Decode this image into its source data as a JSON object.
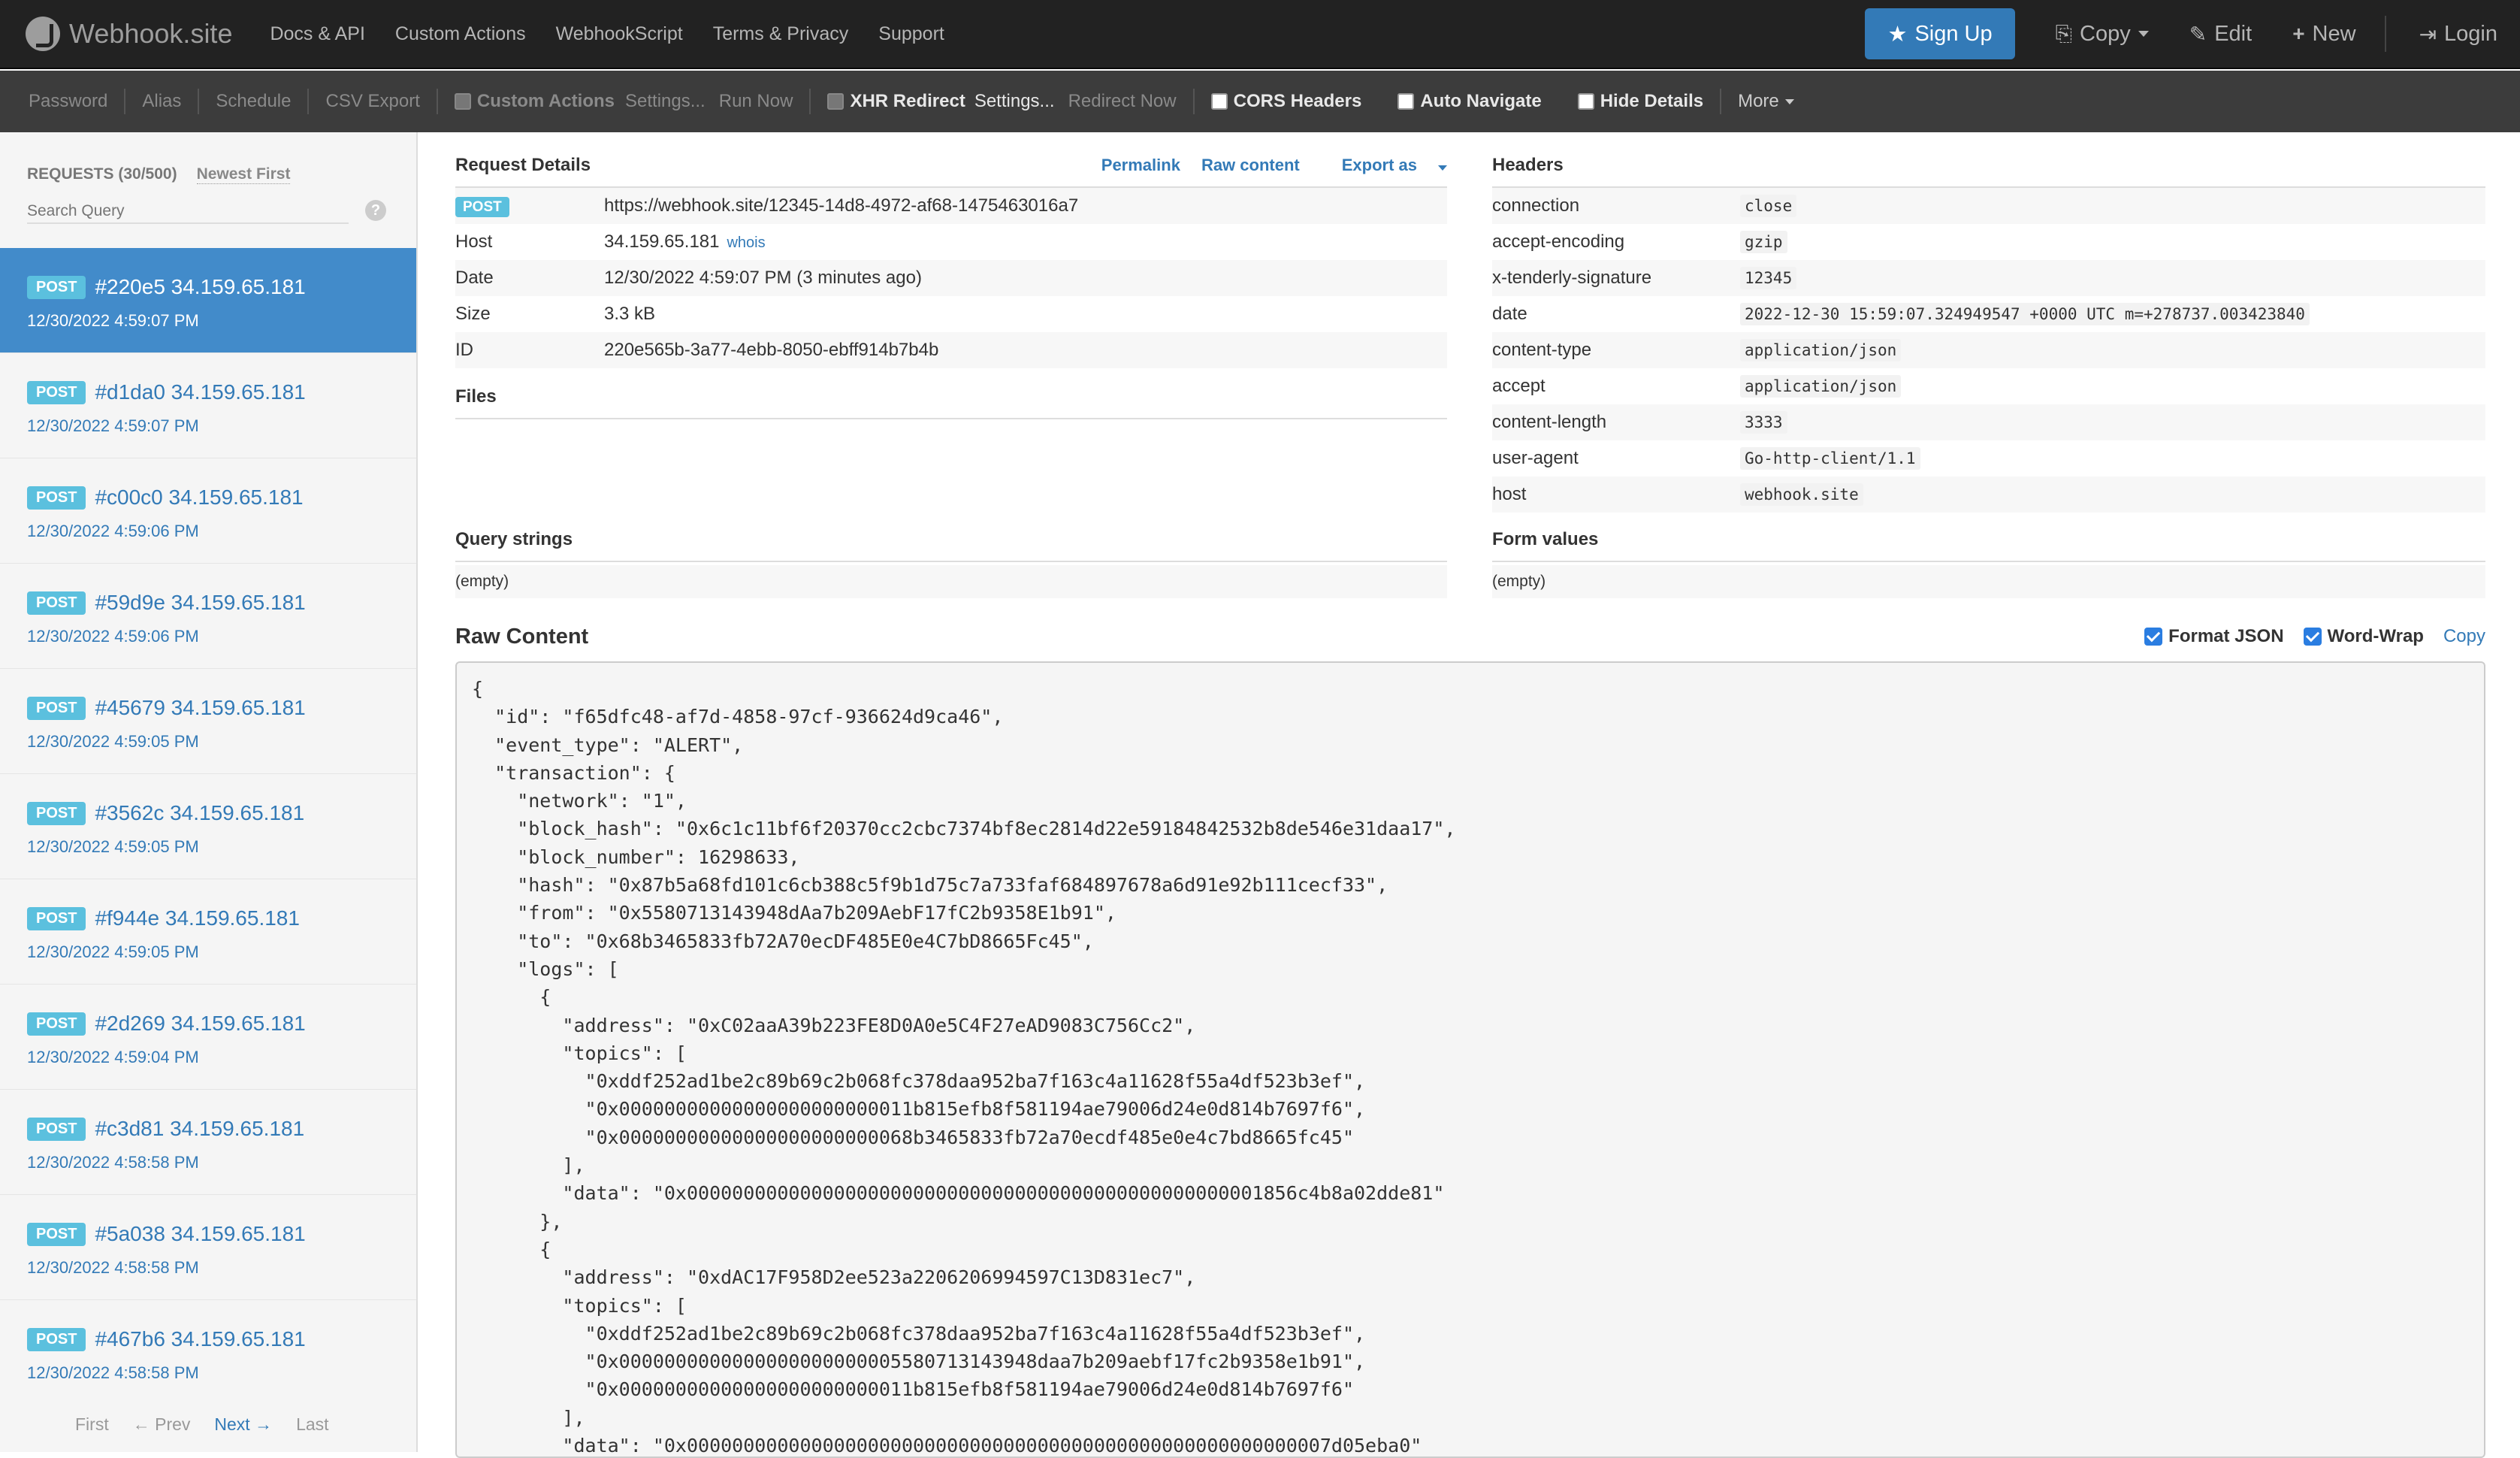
{
  "navbar": {
    "brand": "Webhook.site",
    "links": [
      "Docs & API",
      "Custom Actions",
      "WebhookScript",
      "Terms & Privacy",
      "Support"
    ],
    "signup": "Sign Up",
    "copy": "Copy",
    "edit": "Edit",
    "new": "New",
    "login": "Login"
  },
  "toolbar": {
    "password": "Password",
    "alias": "Alias",
    "schedule": "Schedule",
    "csv_export": "CSV Export",
    "custom_actions": "Custom Actions",
    "custom_settings": "Settings...",
    "run_now": "Run Now",
    "xhr_redirect": "XHR Redirect",
    "xhr_settings": "Settings...",
    "redirect_now": "Redirect Now",
    "cors_headers": "CORS Headers",
    "auto_navigate": "Auto Navigate",
    "hide_details": "Hide Details",
    "more": "More"
  },
  "sidebar": {
    "count": "REQUESTS (30/500)",
    "sort": "Newest First",
    "search_placeholder": "Search Query",
    "help": "?",
    "requests": [
      {
        "method": "POST",
        "title": "#220e5 34.159.65.181",
        "date": "12/30/2022 4:59:07 PM"
      },
      {
        "method": "POST",
        "title": "#d1da0 34.159.65.181",
        "date": "12/30/2022 4:59:07 PM"
      },
      {
        "method": "POST",
        "title": "#c00c0 34.159.65.181",
        "date": "12/30/2022 4:59:06 PM"
      },
      {
        "method": "POST",
        "title": "#59d9e 34.159.65.181",
        "date": "12/30/2022 4:59:06 PM"
      },
      {
        "method": "POST",
        "title": "#45679 34.159.65.181",
        "date": "12/30/2022 4:59:05 PM"
      },
      {
        "method": "POST",
        "title": "#3562c 34.159.65.181",
        "date": "12/30/2022 4:59:05 PM"
      },
      {
        "method": "POST",
        "title": "#f944e 34.159.65.181",
        "date": "12/30/2022 4:59:05 PM"
      },
      {
        "method": "POST",
        "title": "#2d269 34.159.65.181",
        "date": "12/30/2022 4:59:04 PM"
      },
      {
        "method": "POST",
        "title": "#c3d81 34.159.65.181",
        "date": "12/30/2022 4:58:58 PM"
      },
      {
        "method": "POST",
        "title": "#5a038 34.159.65.181",
        "date": "12/30/2022 4:58:58 PM"
      },
      {
        "method": "POST",
        "title": "#467b6 34.159.65.181",
        "date": "12/30/2022 4:58:58 PM"
      }
    ],
    "pager": {
      "first": "First",
      "prev": "← Prev",
      "next": "Next →",
      "last": "Last"
    }
  },
  "request_details": {
    "title": "Request Details",
    "permalink": "Permalink",
    "raw_content": "Raw content",
    "export_as": "Export as",
    "method": "POST",
    "url": "https://webhook.site/12345-14d8-4972-af68-1475463016a7",
    "host_label": "Host",
    "host": "34.159.65.181",
    "whois": "whois",
    "date_label": "Date",
    "date": "12/30/2022 4:59:07 PM (3 minutes ago)",
    "size_label": "Size",
    "size": "3.3 kB",
    "id_label": "ID",
    "id": "220e565b-3a77-4ebb-8050-ebff914b7b4b"
  },
  "headers": {
    "title": "Headers",
    "rows": [
      {
        "key": "connection",
        "value": "close"
      },
      {
        "key": "accept-encoding",
        "value": "gzip"
      },
      {
        "key": "x-tenderly-signature",
        "value": "12345"
      },
      {
        "key": "date",
        "value": "2022-12-30 15:59:07.324949547 +0000 UTC m=+278737.003423840"
      },
      {
        "key": "content-type",
        "value": "application/json"
      },
      {
        "key": "accept",
        "value": "application/json"
      },
      {
        "key": "content-length",
        "value": "3333"
      },
      {
        "key": "user-agent",
        "value": "Go-http-client/1.1"
      },
      {
        "key": "host",
        "value": "webhook.site"
      }
    ]
  },
  "files": {
    "title": "Files"
  },
  "query_strings": {
    "title": "Query strings",
    "value": "(empty)"
  },
  "form_values": {
    "title": "Form values",
    "value": "(empty)"
  },
  "raw": {
    "title": "Raw Content",
    "format_json": "Format JSON",
    "word_wrap": "Word-Wrap",
    "copy": "Copy",
    "content": "{\n  \"id\": \"f65dfc48-af7d-4858-97cf-936624d9ca46\",\n  \"event_type\": \"ALERT\",\n  \"transaction\": {\n    \"network\": \"1\",\n    \"block_hash\": \"0x6c1c11bf6f20370cc2cbc7374bf8ec2814d22e59184842532b8de546e31daa17\",\n    \"block_number\": 16298633,\n    \"hash\": \"0x87b5a68fd101c6cb388c5f9b1d75c7a733faf684897678a6d91e92b111cecf33\",\n    \"from\": \"0x5580713143948dAa7b209AebF17fC2b9358E1b91\",\n    \"to\": \"0x68b3465833fb72A70ecDF485E0e4C7bD8665Fc45\",\n    \"logs\": [\n      {\n        \"address\": \"0xC02aaA39b223FE8D0A0e5C4F27eAD9083C756Cc2\",\n        \"topics\": [\n          \"0xddf252ad1be2c89b69c2b068fc378daa952ba7f163c4a11628f55a4df523b3ef\",\n          \"0x00000000000000000000000011b815efb8f581194ae79006d24e0d814b7697f6\",\n          \"0x00000000000000000000000068b3465833fb72a70ecdf485e0e4c7bd8665fc45\"\n        ],\n        \"data\": \"0x000000000000000000000000000000000000000000000000001856c4b8a02dde81\"\n      },\n      {\n        \"address\": \"0xdAC17F958D2ee523a2206206994597C13D831ec7\",\n        \"topics\": [\n          \"0xddf252ad1be2c89b69c2b068fc378daa952ba7f163c4a11628f55a4df523b3ef\",\n          \"0x0000000000000000000000005580713143948daa7b209aebf17fc2b9358e1b91\",\n          \"0x00000000000000000000000011b815efb8f581194ae79006d24e0d814b7697f6\"\n        ],\n        \"data\": \"0x000000000000000000000000000000000000000000000000000000007d05eba0\""
  }
}
